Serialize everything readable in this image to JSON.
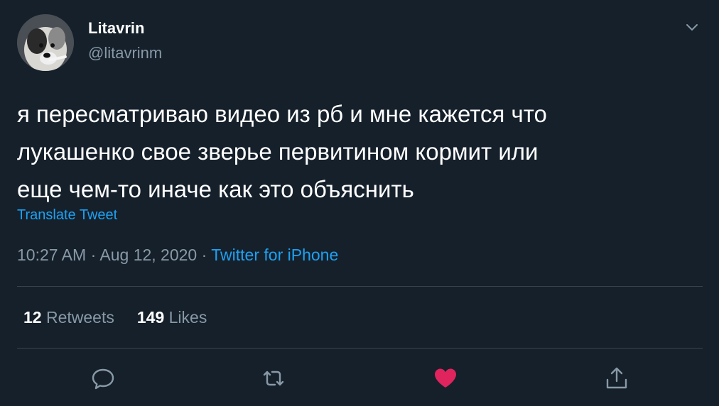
{
  "tweet": {
    "author": {
      "display_name": "Litavrin",
      "handle": "@litavrinm"
    },
    "text_lines": [
      "я пересматриваю видео из рб и мне кажется что",
      "лукашенко свое зверье первитином кормит или",
      "еще чем-то иначе как это объяснить"
    ],
    "translate_label": "Translate Tweet",
    "time": "10:27 AM",
    "date": "Aug 12, 2020",
    "separator": "·",
    "source": "Twitter for iPhone"
  },
  "stats": {
    "retweets_count": "12",
    "retweets_label": "Retweets",
    "likes_count": "149",
    "likes_label": "Likes"
  },
  "icons": {
    "menu": "chevron-down-icon",
    "reply": "reply-icon",
    "retweet": "retweet-icon",
    "like": "heart-icon",
    "share": "share-icon"
  },
  "colors": {
    "background": "#15202b",
    "text": "#ffffff",
    "secondary": "#8899a6",
    "link": "#1da1f2",
    "like_active": "#e0245e",
    "divider": "#38444d"
  }
}
